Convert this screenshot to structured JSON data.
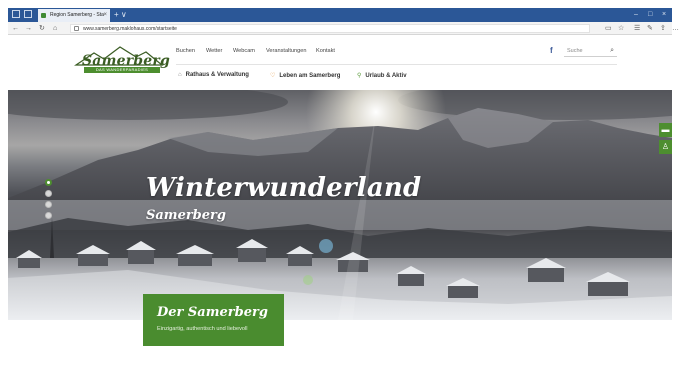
{
  "browser": {
    "tab_title": "Region Samerberg - Sta",
    "tab_close": "×",
    "new_tab": "+ ∨",
    "url": "www.samerberg.maklohaus.com/startseite",
    "nav_icons": [
      "back-icon",
      "forward-icon",
      "refresh-icon",
      "home-icon"
    ],
    "window_controls": [
      "–",
      "□",
      "×"
    ]
  },
  "site": {
    "logo": {
      "name": "Samerberg",
      "tagline": "DAS WANDERPARADIES"
    },
    "main_nav": [
      "Buchen",
      "Wetter",
      "Webcam",
      "Veranstaltungen",
      "Kontakt"
    ],
    "facebook": "f",
    "search_placeholder": "Suche",
    "sub_nav": [
      {
        "label": "Rathaus & Verwaltung",
        "icon": "house-icon"
      },
      {
        "label": "Leben am Samerberg",
        "icon": "heart-icon"
      },
      {
        "label": "Urlaub & Aktiv",
        "icon": "hiker-icon"
      }
    ],
    "hero": {
      "title": "Winterwunderland",
      "subtitle": "Samerberg",
      "slide_count": 4,
      "active_slide": 1
    },
    "card": {
      "title": "Der Samerberg",
      "subtitle": "Einzigartig, authentisch und liebevoll"
    },
    "colors": {
      "brand_green": "#4a8c2f",
      "browser_blue": "#2b5797"
    }
  }
}
